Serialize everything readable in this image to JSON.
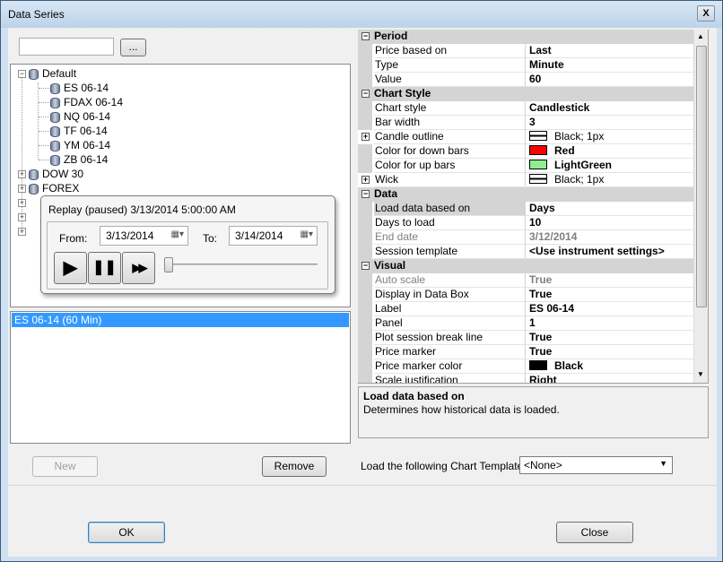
{
  "window": {
    "title": "Data Series",
    "close_glyph": "X"
  },
  "search": {
    "value": "",
    "browse_label": "..."
  },
  "tree": {
    "root": "Default",
    "children": [
      "ES 06-14",
      "FDAX 06-14",
      "NQ 06-14",
      "TF 06-14",
      "YM 06-14",
      "ZB 06-14"
    ],
    "groups": [
      "DOW 30",
      "FOREX"
    ]
  },
  "replay": {
    "title": "Replay (paused) 3/13/2014 5:00:00 AM",
    "from_label": "From:",
    "from_value": "3/13/2014",
    "to_label": "To:",
    "to_value": "3/14/2014",
    "play_glyph": "▶",
    "pause_glyph": "❚❚",
    "ff_glyph": "▶▶",
    "progress": 0
  },
  "series_list": [
    "ES 06-14 (60 Min)"
  ],
  "buttons": {
    "new": "New",
    "remove": "Remove",
    "ok": "OK",
    "close": "Close"
  },
  "properties": {
    "period": {
      "category": "Period",
      "rows": [
        {
          "name": "Price based on",
          "value": "Last"
        },
        {
          "name": "Type",
          "value": "Minute"
        },
        {
          "name": "Value",
          "value": "60"
        }
      ]
    },
    "chart_style": {
      "category": "Chart Style",
      "rows": [
        {
          "name": "Chart style",
          "value": "Candlestick"
        },
        {
          "name": "Bar width",
          "value": "3"
        },
        {
          "name": "Candle outline",
          "value": "Black; 1px"
        },
        {
          "name": "Color for down bars",
          "value": "Red"
        },
        {
          "name": "Color for up bars",
          "value": "LightGreen"
        },
        {
          "name": "Wick",
          "value": "Black; 1px"
        }
      ]
    },
    "data": {
      "category": "Data",
      "rows": [
        {
          "name": "Load data based on",
          "value": "Days"
        },
        {
          "name": "Days to load",
          "value": "10"
        },
        {
          "name": "End date",
          "value": "3/12/2014"
        },
        {
          "name": "Session template",
          "value": "<Use instrument settings>"
        }
      ]
    },
    "visual": {
      "category": "Visual",
      "rows": [
        {
          "name": "Auto scale",
          "value": "True"
        },
        {
          "name": "Display in Data Box",
          "value": "True"
        },
        {
          "name": "Label",
          "value": "ES 06-14"
        },
        {
          "name": "Panel",
          "value": "1"
        },
        {
          "name": "Plot session break line",
          "value": "True"
        },
        {
          "name": "Price marker",
          "value": "True"
        },
        {
          "name": "Price marker color",
          "value": "Black"
        },
        {
          "name": "Scale justification",
          "value": "Right"
        }
      ]
    },
    "expand_glyph": "+",
    "collapse_glyph": "−"
  },
  "description": {
    "title": "Load data based on",
    "text": "Determines how historical data is loaded."
  },
  "template": {
    "label": "Load the following Chart Template:",
    "value": "<None>"
  },
  "colors": {
    "red": "#ff0000",
    "lightgreen": "#90ee90",
    "black": "#000000",
    "selection": "#3399ff"
  }
}
